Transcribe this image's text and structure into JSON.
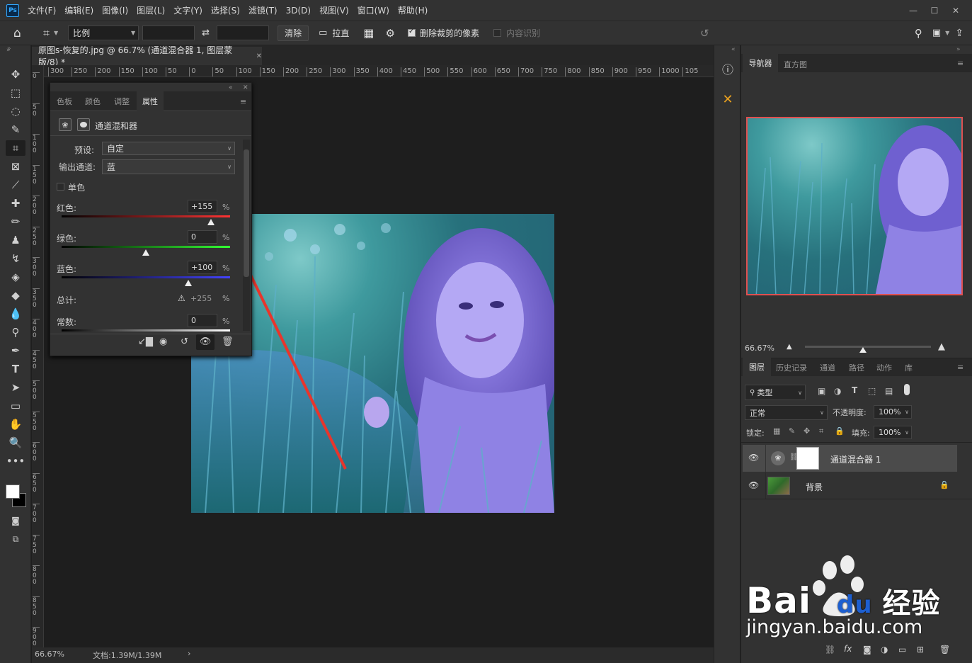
{
  "menu": {
    "logo": "Ps",
    "items": [
      "文件(F)",
      "编辑(E)",
      "图像(I)",
      "图层(L)",
      "文字(Y)",
      "选择(S)",
      "滤镜(T)",
      "3D(D)",
      "视图(V)",
      "窗口(W)",
      "帮助(H)"
    ]
  },
  "options": {
    "ratio_label": "比例",
    "clear_label": "清除",
    "straighten_label": "拉直",
    "delete_cropped_label": "删除裁剪的像素",
    "delete_cropped_checked": true,
    "content_aware_label": "内容识别",
    "content_aware_checked": false
  },
  "document": {
    "tab_title": "原图s-恢复的.jpg @ 66.7% (通道混合器 1, 图层蒙版/8) *",
    "ruler_h_ticks": [
      "300",
      "250",
      "200",
      "150",
      "100",
      "50",
      "0",
      "50",
      "100",
      "150",
      "200",
      "250",
      "300",
      "350",
      "400",
      "450",
      "500",
      "550",
      "600",
      "650",
      "700",
      "750",
      "800",
      "850",
      "900",
      "950",
      "1000",
      "105"
    ],
    "ruler_v_ticks": [
      "0",
      "5 0",
      "1 0 0",
      "1 5 0",
      "2 0 0",
      "2 5 0",
      "3 0 0",
      "3 5 0",
      "4 0 0",
      "4 5 0",
      "5 0 0",
      "5 5 0",
      "6 0 0",
      "6 5 0",
      "7 0 0",
      "7 5 0",
      "8 0 0",
      "8 5 0",
      "9 0 0"
    ]
  },
  "status": {
    "zoom": "66.67%",
    "doc_info": "文档:1.39M/1.39M"
  },
  "properties": {
    "tabs": [
      "色板",
      "颜色",
      "调整",
      "属性"
    ],
    "active_tab": "属性",
    "title": "通道混和器",
    "preset_label": "预设:",
    "preset_value": "自定",
    "output_label": "输出通道:",
    "output_value": "蓝",
    "mono_label": "单色",
    "red_label": "红色:",
    "red_value": "+155",
    "green_label": "绿色:",
    "green_value": "0",
    "blue_label": "蓝色:",
    "blue_value": "+100",
    "total_label": "总计:",
    "total_value": "+255",
    "const_label": "常数:",
    "const_value": "0",
    "percent": "%",
    "red_level": 155,
    "green_level": 0,
    "blue_level": 100
  },
  "navigator": {
    "tabs": [
      "导航器",
      "直方图"
    ],
    "zoom": "66.67%"
  },
  "layers_panel": {
    "tabs": [
      "图层",
      "历史记录",
      "通道",
      "路径",
      "动作",
      "库"
    ],
    "filter_kind": "类型",
    "blend_mode": "正常",
    "opacity_label": "不透明度:",
    "opacity_value": "100%",
    "lock_label": "锁定:",
    "fill_label": "填充:",
    "fill_value": "100%",
    "layers": [
      {
        "name": "通道混合器 1"
      },
      {
        "name": "背景"
      }
    ]
  },
  "watermark": {
    "brand_a": "Bai",
    "brand_b": "du",
    "brand_c": "经验",
    "url": "jingyan.baidu.com"
  },
  "colors": {
    "accent_red": "#e8352c",
    "photo_dark": "#1e5c6a",
    "photo_light": "#7a8cf0"
  }
}
